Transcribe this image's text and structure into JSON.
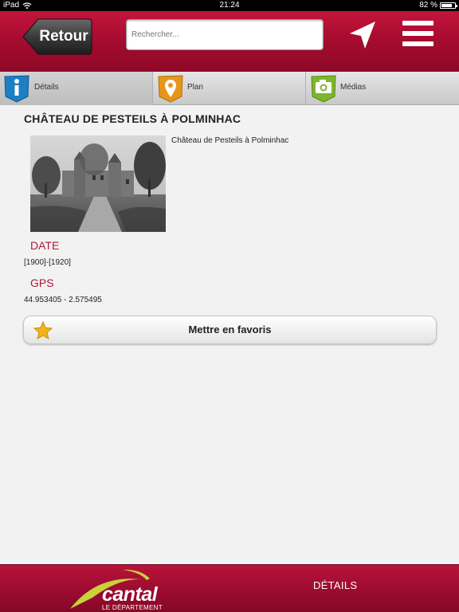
{
  "status_bar": {
    "device": "iPad",
    "time": "21:24",
    "battery": "82 %",
    "battery_level": 0.82
  },
  "header": {
    "back_label": "Retour",
    "search_placeholder": "Rechercher..."
  },
  "tabs": [
    {
      "label": "Détails",
      "icon": "info-icon",
      "color": "#1c7fc4"
    },
    {
      "label": "Plan",
      "icon": "map-pin-icon",
      "color": "#e5961b"
    },
    {
      "label": "Médias",
      "icon": "camera-icon",
      "color": "#7db62c"
    }
  ],
  "content": {
    "title": "CHÂTEAU DE PESTEILS À POLMINHAC",
    "caption": "Château de Pesteils à Polminhac",
    "date_label": "DATE",
    "date_value": "[1900]-[1920]",
    "gps_label": "GPS",
    "gps_value": "44.953405 - 2.575495",
    "favorite_label": "Mettre en favoris"
  },
  "footer": {
    "logo_text": "cantal",
    "logo_subtitle": "LE DÉPARTEMENT",
    "active_tab": "DÉTAILS"
  },
  "colors": {
    "brand_red": "#a80c30",
    "label_red": "#b1173b",
    "logo_arc_green": "#c8d23a"
  }
}
